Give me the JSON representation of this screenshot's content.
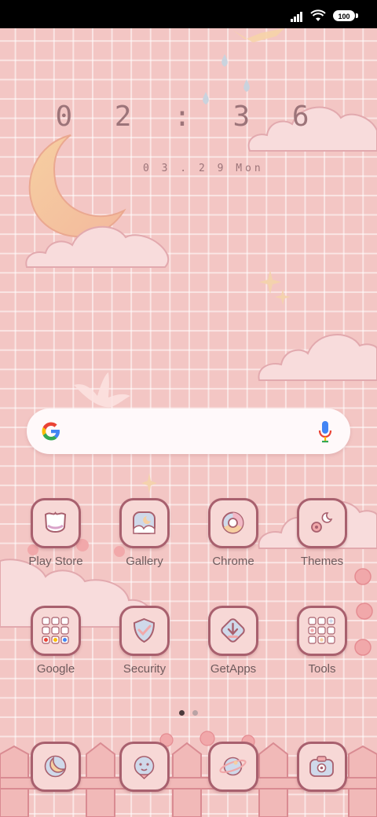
{
  "status_bar": {
    "battery": "100"
  },
  "clock": {
    "time": "0 2 : 3 6",
    "date": "0 3 . 2 9 Mon"
  },
  "search": {
    "placeholder": ""
  },
  "apps_row1": [
    {
      "label": "Play Store",
      "icon": "play-store-icon"
    },
    {
      "label": "Gallery",
      "icon": "gallery-icon"
    },
    {
      "label": "Chrome",
      "icon": "chrome-icon"
    },
    {
      "label": "Themes",
      "icon": "themes-icon"
    }
  ],
  "apps_row2": [
    {
      "label": "Google",
      "icon": "google-folder-icon"
    },
    {
      "label": "Security",
      "icon": "security-icon"
    },
    {
      "label": "GetApps",
      "icon": "getapps-icon"
    },
    {
      "label": "Tools",
      "icon": "tools-folder-icon"
    }
  ],
  "dock": [
    {
      "icon": "phone-icon"
    },
    {
      "icon": "messages-icon"
    },
    {
      "icon": "browser-icon"
    },
    {
      "icon": "camera-icon"
    }
  ],
  "pager": {
    "active_color": "#4a3a3c",
    "inactive_color": "#b9a3a5",
    "pages": 2,
    "current": 1
  },
  "colors": {
    "background": "#f3c6c4",
    "icon_border": "#a8606e",
    "label": "#6f5b5d"
  }
}
